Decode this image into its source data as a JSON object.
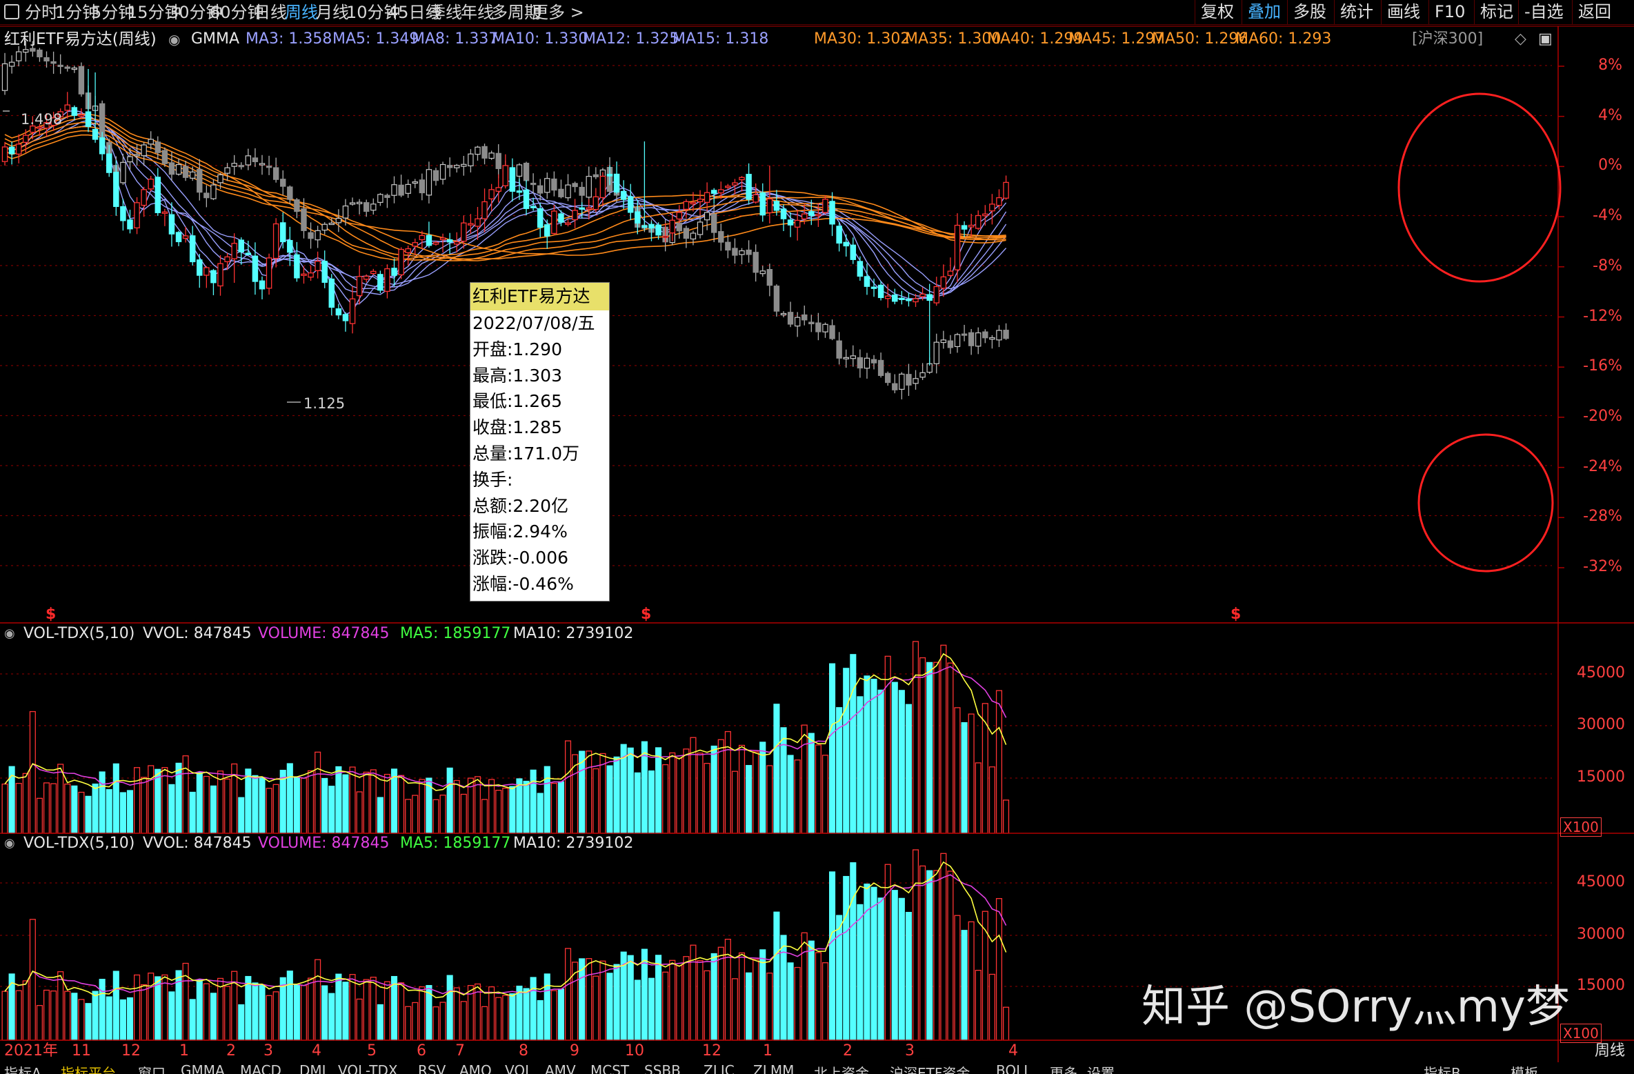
{
  "toolbar": {
    "panel_toggle_icon": "panel-toggle-icon",
    "periods": [
      "分时",
      "1分钟",
      "5分钟",
      "15分钟",
      "30分钟",
      "60分钟",
      "日线",
      "周线",
      "月线",
      "10分钟",
      "45日线",
      "季线",
      "年线",
      "多周期",
      "更多 >"
    ],
    "active_period": "周线",
    "right_buttons": [
      "复权",
      "叠加",
      "多股",
      "统计",
      "画线",
      "F10",
      "标记",
      "-自选",
      "返回"
    ],
    "active_right": "叠加"
  },
  "main_header": {
    "title": "红利ETF易方达(周线)",
    "indicator": "GMMA",
    "mas": [
      {
        "label": "MA3: 1.358",
        "color": "#9aa0ff"
      },
      {
        "label": "MA5: 1.349",
        "color": "#9aa0ff"
      },
      {
        "label": "MA8: 1.337",
        "color": "#9aa0ff"
      },
      {
        "label": "MA10: 1.330",
        "color": "#9aa0ff"
      },
      {
        "label": "MA12: 1.325",
        "color": "#9aa0ff"
      },
      {
        "label": "MA15: 1.318",
        "color": "#9aa0ff"
      },
      {
        "label": "MA30: 1.302",
        "color": "#ff9a2a"
      },
      {
        "label": "MA35: 1.300",
        "color": "#ff9a2a"
      },
      {
        "label": "MA40: 1.299",
        "color": "#ff9a2a"
      },
      {
        "label": "MA45: 1.297",
        "color": "#ff9a2a"
      },
      {
        "label": "MA50: 1.296",
        "color": "#ff9a2a"
      },
      {
        "label": "MA60: 1.293",
        "color": "#ff9a2a"
      }
    ],
    "overlay_label": "[沪深300]",
    "right_icons": [
      "diamond-icon",
      "window-toggle-icon"
    ]
  },
  "price_axis": [
    "8%",
    "4%",
    "0%",
    "-4%",
    "-8%",
    "-12%",
    "-16%",
    "-20%",
    "-24%",
    "-28%",
    "-32%"
  ],
  "annotations": {
    "high_label": "1.498",
    "low_label": "1.125",
    "dividend_marker": "$"
  },
  "tooltip": {
    "title": "红利ETF易方达",
    "date": "2022/07/08/五",
    "open": "开盘:1.290",
    "high": "最高:1.303",
    "low": "最低:1.265",
    "close": "收盘:1.285",
    "volume": "总量:171.0万",
    "turnover": "换手:",
    "amount": "总额:2.20亿",
    "amplitude": "振幅:2.94%",
    "change": "涨跌:-0.006",
    "change_pct": "涨幅:-0.46%"
  },
  "vol_header": {
    "name": "VOL-TDX(5,10)",
    "vvol": "VVOL: 847845",
    "volume": "VOLUME: 847845",
    "ma5": "MA5: 1859177",
    "ma10": "MA10: 2739102"
  },
  "vol_axis": [
    "45000",
    "30000",
    "15000"
  ],
  "vol_unit": "X100",
  "time_axis": [
    "2021年",
    "11",
    "12",
    "1",
    "2",
    "3",
    "4",
    "5",
    "6",
    "7",
    "8",
    "9",
    "10",
    "12",
    "1",
    "2",
    "3",
    "4"
  ],
  "bottom_tabs": [
    "指标A",
    "指标平台",
    "窗口",
    "GMMA",
    "MACD",
    "DMI",
    "VOL-TDX",
    "RSV",
    "AMO",
    "VOL",
    "AMV",
    "MCST",
    "SSBB",
    "ZLJC",
    "ZLMM",
    "北上资金",
    "沪深ETF资金",
    "BOLL",
    "更多",
    "设置"
  ],
  "active_bottom_tab": "指标平台",
  "bottom_right": [
    "指标B",
    "模板",
    "周线"
  ],
  "watermark": "知乎 @SOrry灬my梦",
  "colors": {
    "up": "#ff3333",
    "down": "#54ffff",
    "overlay": "#8c8c8c",
    "grid": "#7a0000",
    "short_ma": "#9aa0ff",
    "long_ma": "#ff8a1a",
    "vol_ma5": "#ffff40",
    "vol_ma10": "#e040e0",
    "circle": "#ff2020"
  }
}
